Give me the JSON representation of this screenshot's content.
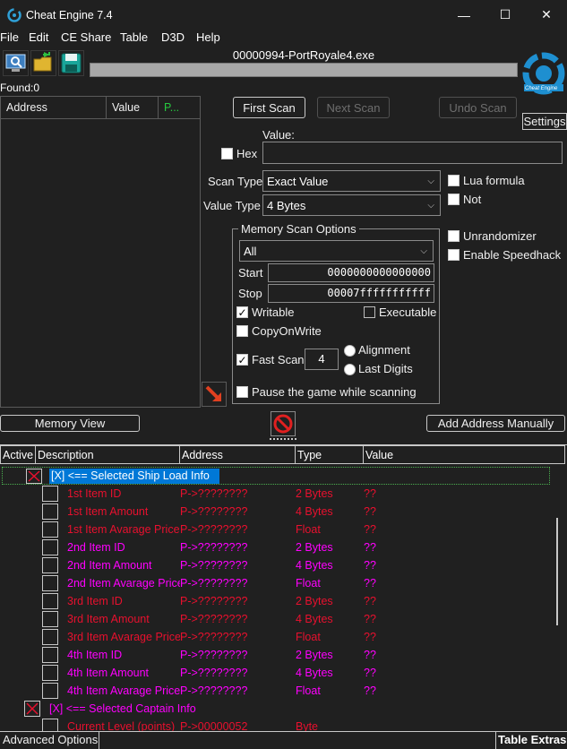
{
  "window": {
    "title": "Cheat Engine 7.4"
  },
  "menu": [
    "File",
    "Edit",
    "CE Share",
    "Table",
    "D3D",
    "Help"
  ],
  "process": {
    "name": "00000994-PortRoyale4.exe"
  },
  "found": {
    "label": "Found:",
    "count": "0"
  },
  "found_list": {
    "columns": [
      "Address",
      "Value",
      "P..."
    ]
  },
  "scan": {
    "first_scan": "First Scan",
    "next_scan": "Next Scan",
    "undo_scan": "Undo Scan",
    "settings": "Settings",
    "value_label": "Value:",
    "hex_label": "Hex",
    "value_input": "",
    "scan_type_label": "Scan Type",
    "scan_type_value": "Exact Value",
    "value_type_label": "Value Type",
    "value_type_value": "4 Bytes",
    "lua_formula": "Lua formula",
    "not_label": "Not",
    "unrandomizer": "Unrandomizer",
    "speedhack": "Enable Speedhack"
  },
  "memory_options": {
    "title": "Memory Scan Options",
    "region": "All",
    "start_label": "Start",
    "start_value": "0000000000000000",
    "stop_label": "Stop",
    "stop_value": "00007fffffffffff",
    "writable": "Writable",
    "executable": "Executable",
    "copy_on_write": "CopyOnWrite",
    "fast_scan": "Fast Scan",
    "fast_scan_value": "4",
    "alignment": "Alignment",
    "last_digits": "Last Digits",
    "pause_game": "Pause the game while scanning"
  },
  "buttons": {
    "memory_view": "Memory View",
    "add_address": "Add Address Manually"
  },
  "table": {
    "columns": [
      "Active",
      "Description",
      "Address",
      "Type",
      "Value"
    ],
    "group1": "[X] <== Selected Ship Load Info",
    "rows": [
      {
        "desc": "1st Item ID",
        "addr": "P->????????",
        "type": "2 Bytes",
        "value": "??",
        "color": "red"
      },
      {
        "desc": "1st Item Amount",
        "addr": "P->????????",
        "type": "4 Bytes",
        "value": "??",
        "color": "red"
      },
      {
        "desc": "1st Item Avarage Price",
        "addr": "P->????????",
        "type": "Float",
        "value": "??",
        "color": "red"
      },
      {
        "desc": "2nd Item ID",
        "addr": "P->????????",
        "type": "2 Bytes",
        "value": "??",
        "color": "pink"
      },
      {
        "desc": "2nd Item Amount",
        "addr": "P->????????",
        "type": "4 Bytes",
        "value": "??",
        "color": "pink"
      },
      {
        "desc": "2nd Item Avarage Price",
        "addr": "P->????????",
        "type": "Float",
        "value": "??",
        "color": "pink"
      },
      {
        "desc": "3rd Item ID",
        "addr": "P->????????",
        "type": "2 Bytes",
        "value": "??",
        "color": "red"
      },
      {
        "desc": "3rd Item Amount",
        "addr": "P->????????",
        "type": "4 Bytes",
        "value": "??",
        "color": "red"
      },
      {
        "desc": "3rd Item Avarage Price",
        "addr": "P->????????",
        "type": "Float",
        "value": "??",
        "color": "red"
      },
      {
        "desc": "4th Item ID",
        "addr": "P->????????",
        "type": "2 Bytes",
        "value": "??",
        "color": "pink"
      },
      {
        "desc": "4th Item Amount",
        "addr": "P->????????",
        "type": "4 Bytes",
        "value": "??",
        "color": "pink"
      },
      {
        "desc": "4th Item Avarage Price",
        "addr": "P->????????",
        "type": "Float",
        "value": "??",
        "color": "pink"
      }
    ],
    "group2": "[X] <== Selected Captain Info",
    "partial_row": {
      "desc": "Current Level (points)",
      "addr": "P->00000052",
      "type": "Byte"
    }
  },
  "footer": {
    "advanced_options": "Advanced Options",
    "table_extras": "Table Extras"
  },
  "colors": {
    "red": "#e8102e",
    "pink": "#ff00ff",
    "selection": "#0078d7"
  }
}
